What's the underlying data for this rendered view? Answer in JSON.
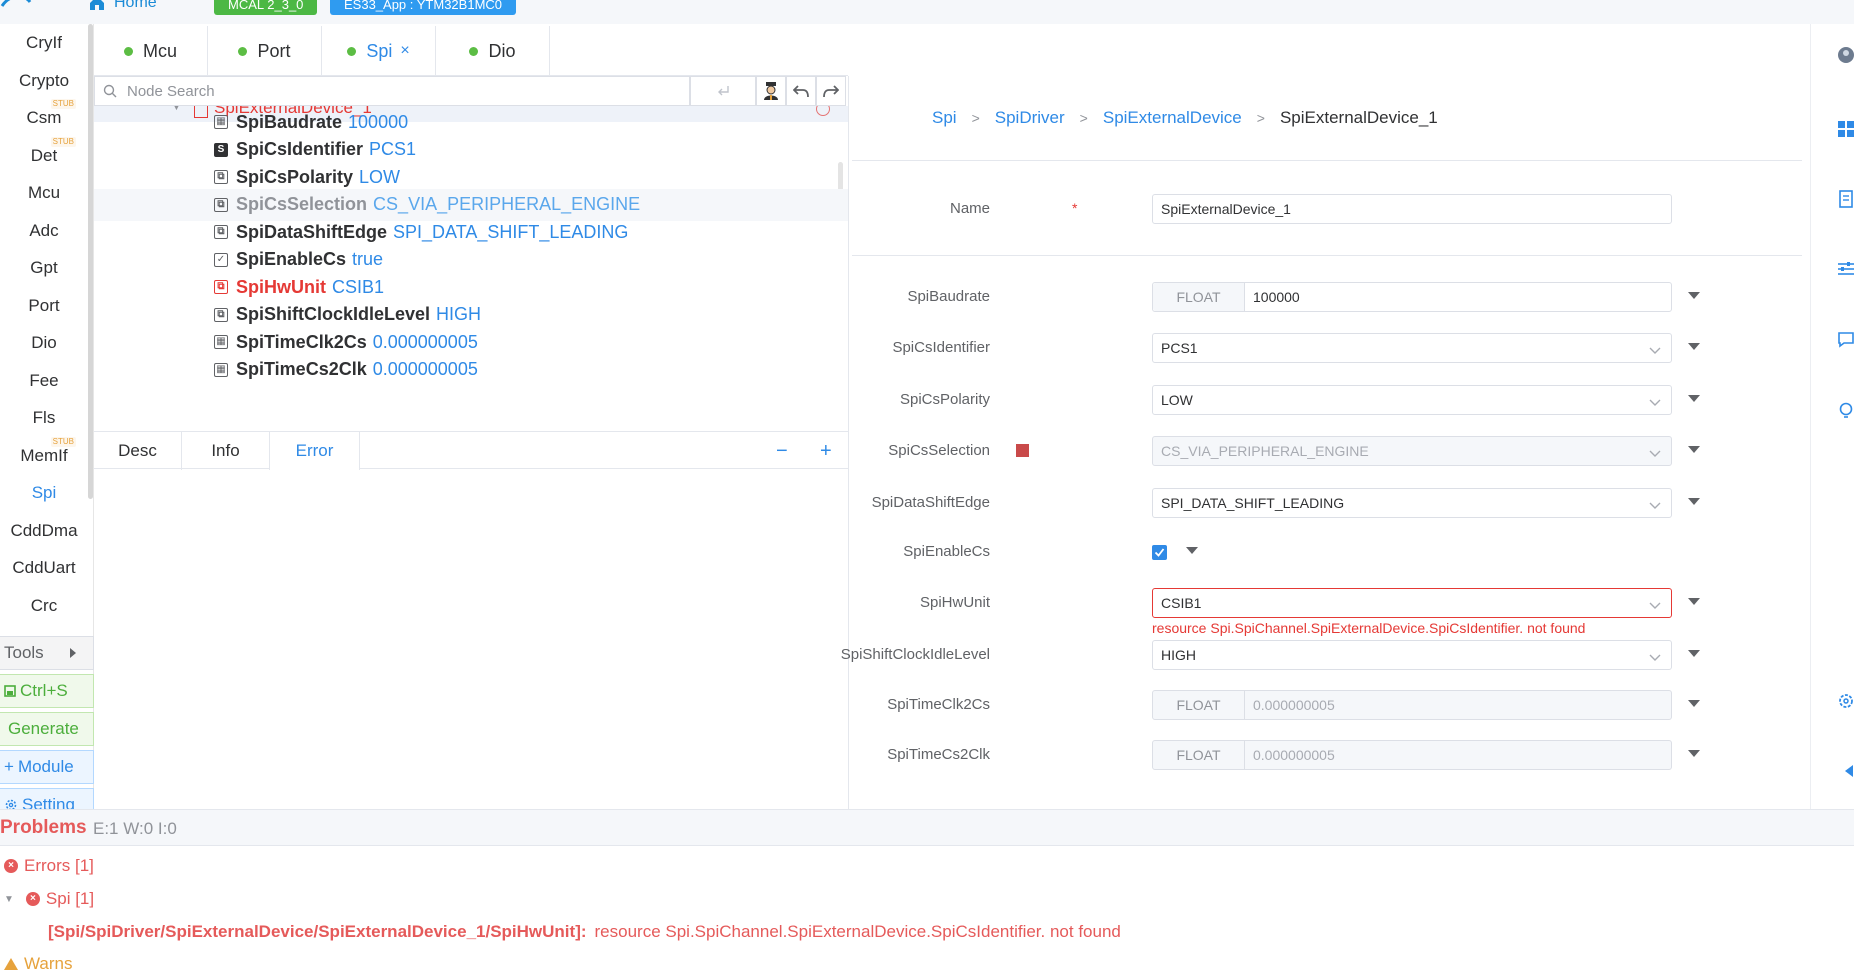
{
  "header": {
    "home_label": "Home",
    "mcal_badge": "MCAL 2_3_0",
    "project_badge": "ES33_App : YTM32B1MC0",
    "brand_color": "#1b8bd6"
  },
  "sidebar": {
    "modules": [
      {
        "label": "CryIf",
        "stub": ""
      },
      {
        "label": "Crypto",
        "stub": ""
      },
      {
        "label": "Csm",
        "stub": "STUB"
      },
      {
        "label": "Det",
        "stub": "STUB"
      },
      {
        "label": "Mcu",
        "stub": ""
      },
      {
        "label": "Adc",
        "stub": ""
      },
      {
        "label": "Gpt",
        "stub": ""
      },
      {
        "label": "Port",
        "stub": ""
      },
      {
        "label": "Dio",
        "stub": ""
      },
      {
        "label": "Fee",
        "stub": ""
      },
      {
        "label": "Fls",
        "stub": ""
      },
      {
        "label": "MemIf",
        "stub": "STUB"
      },
      {
        "label": "Spi",
        "stub": ""
      },
      {
        "label": "CddDma",
        "stub": ""
      },
      {
        "label": "CddUart",
        "stub": ""
      },
      {
        "label": "Crc",
        "stub": ""
      }
    ],
    "active_module": "Spi",
    "tools_label": "Tools",
    "save_label": "Ctrl+S",
    "generate_label": "Generate",
    "module_label": "Module",
    "setting_label": "Setting"
  },
  "tabs": [
    {
      "label": "Mcu",
      "closable": false,
      "active": false
    },
    {
      "label": "Port",
      "closable": false,
      "active": false
    },
    {
      "label": "Spi",
      "closable": true,
      "active": true
    },
    {
      "label": "Dio",
      "closable": false,
      "active": false
    }
  ],
  "tree": {
    "search_placeholder": "Node Search",
    "parent_node": "SpiExternalDevice_1",
    "rows": [
      {
        "name": "SpiBaudrate",
        "value": "100000",
        "icon": "float-param-icon",
        "state": "normal"
      },
      {
        "name": "SpiCsIdentifier",
        "value": "PCS1",
        "icon": "string-param-icon",
        "state": "normal"
      },
      {
        "name": "SpiCsPolarity",
        "value": "LOW",
        "icon": "enum-param-icon",
        "state": "normal"
      },
      {
        "name": "SpiCsSelection",
        "value": "CS_VIA_PERIPHERAL_ENGINE",
        "icon": "enum-param-icon",
        "state": "disabled"
      },
      {
        "name": "SpiDataShiftEdge",
        "value": "SPI_DATA_SHIFT_LEADING",
        "icon": "enum-param-icon",
        "state": "normal"
      },
      {
        "name": "SpiEnableCs",
        "value": "true",
        "icon": "boolean-param-icon",
        "state": "normal"
      },
      {
        "name": "SpiHwUnit",
        "value": "CSIB1",
        "icon": "reference-param-icon",
        "state": "error"
      },
      {
        "name": "SpiShiftClockIdleLevel",
        "value": "HIGH",
        "icon": "enum-param-icon",
        "state": "normal"
      },
      {
        "name": "SpiTimeClk2Cs",
        "value": "0.000000005",
        "icon": "float-param-icon",
        "state": "normal"
      },
      {
        "name": "SpiTimeCs2Clk",
        "value": "0.000000005",
        "icon": "float-param-icon",
        "state": "normal"
      }
    ]
  },
  "detail_tabs": [
    {
      "label": "Desc",
      "active": false
    },
    {
      "label": "Info",
      "active": false
    },
    {
      "label": "Error",
      "active": true
    }
  ],
  "breadcrumb": [
    "Spi",
    "SpiDriver",
    "SpiExternalDevice",
    "SpiExternalDevice_1"
  ],
  "form": {
    "name_label": "Name",
    "name_value": "SpiExternalDevice_1",
    "fields": [
      {
        "label": "SpiBaudrate",
        "kind": "float",
        "type_tag": "FLOAT",
        "value": "100000",
        "disabled": false
      },
      {
        "label": "SpiCsIdentifier",
        "kind": "select",
        "value": "PCS1",
        "disabled": false
      },
      {
        "label": "SpiCsPolarity",
        "kind": "select",
        "value": "LOW",
        "disabled": false
      },
      {
        "label": "SpiCsSelection",
        "kind": "select",
        "value": "CS_VIA_PERIPHERAL_ENGINE",
        "disabled": true
      },
      {
        "label": "SpiDataShiftEdge",
        "kind": "select",
        "value": "SPI_DATA_SHIFT_LEADING",
        "disabled": false
      },
      {
        "label": "SpiEnableCs",
        "kind": "checkbox",
        "checked": true
      },
      {
        "label": "SpiHwUnit",
        "kind": "select",
        "value": "CSIB1",
        "error": "resource Spi.SpiChannel.SpiExternalDevice.SpiCsIdentifier. not found"
      },
      {
        "label": "SpiShiftClockIdleLevel",
        "kind": "select",
        "value": "HIGH",
        "disabled": false
      },
      {
        "label": "SpiTimeClk2Cs",
        "kind": "float",
        "type_tag": "FLOAT",
        "value": "0.000000005",
        "disabled": true
      },
      {
        "label": "SpiTimeCs2Clk",
        "kind": "float",
        "type_tag": "FLOAT",
        "value": "0.000000005",
        "disabled": true
      }
    ]
  },
  "problems": {
    "title": "Problems",
    "counts": "E:1 W:0 I:0",
    "errors_label": "Errors [1]",
    "module_group": "Spi [1]",
    "error_path": "[Spi/SpiDriver/SpiExternalDevice/SpiExternalDevice_1/SpiHwUnit]:",
    "error_message": "resource Spi.SpiChannel.SpiExternalDevice.SpiCsIdentifier. not found",
    "warns_label": "Warns"
  },
  "colors": {
    "accent": "#2f8ae6",
    "error": "#e53935",
    "success": "#4cb844",
    "warning": "#e6a23c"
  }
}
